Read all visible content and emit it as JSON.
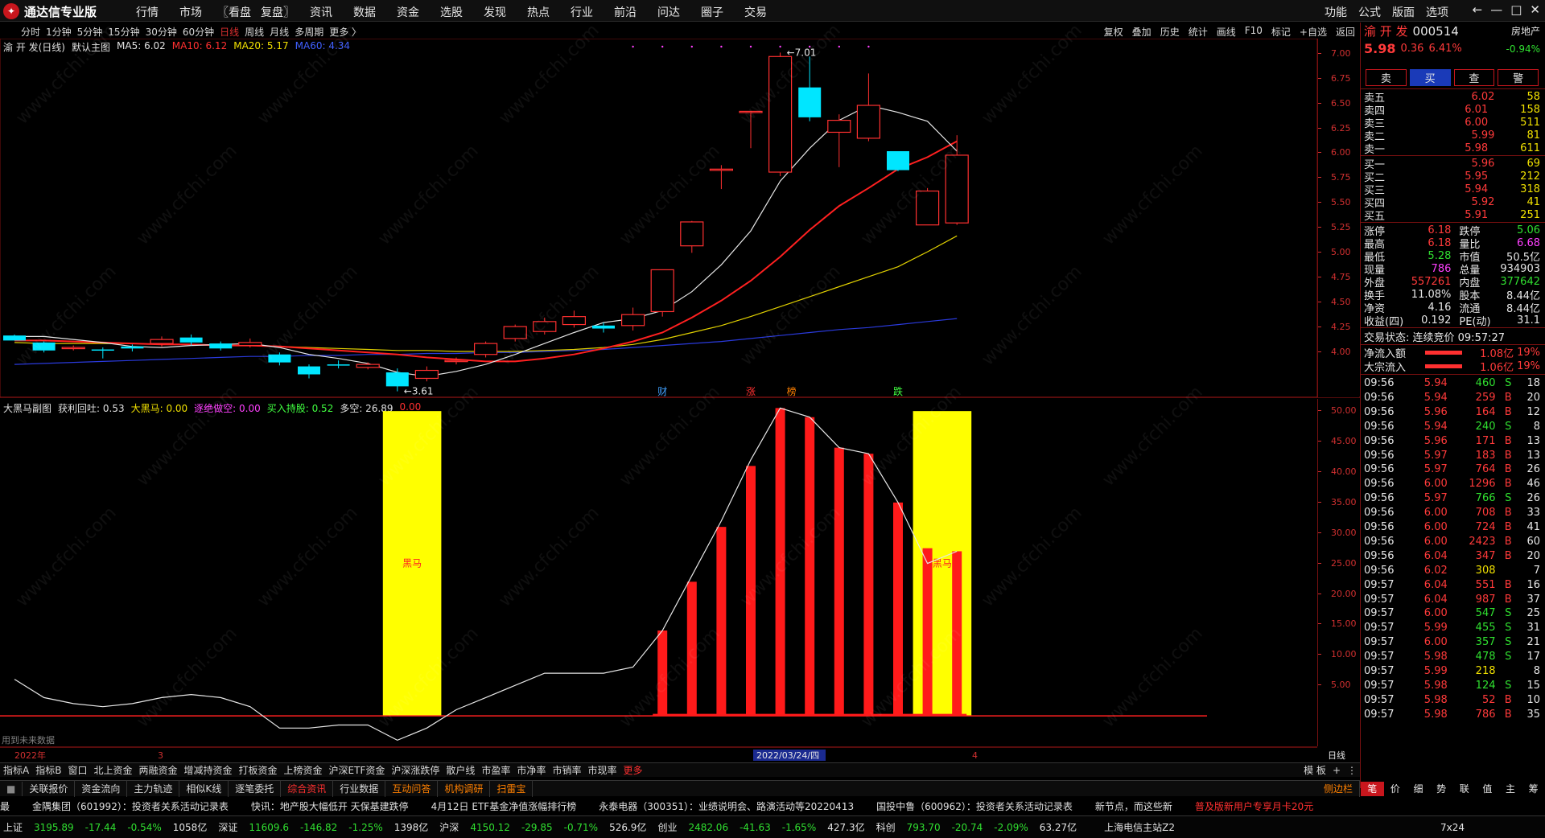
{
  "app": {
    "name": "通达信专业版",
    "logo_icon": "tdx-logo-icon"
  },
  "main_menu": [
    "行情",
    "市场",
    "〖看盘",
    "复盘〗",
    "资讯",
    "数据",
    "资金",
    "选股",
    "发现",
    "热点",
    "行业",
    "前沿",
    "问达",
    "圈子",
    "交易"
  ],
  "right_menu": [
    "功能",
    "公式",
    "版面",
    "选项"
  ],
  "window_controls": [
    "←",
    "—",
    "□",
    "✕"
  ],
  "periods": [
    "分时",
    "1分钟",
    "5分钟",
    "15分钟",
    "30分钟",
    "60分钟",
    "日线",
    "周线",
    "月线",
    "多周期",
    "更多 〉"
  ],
  "active_period": "日线",
  "tool_buttons": [
    "复权",
    "叠加",
    "历史",
    "统计",
    "画线",
    "F10",
    "标记",
    "+自选",
    "返回"
  ],
  "stock": {
    "name": "渝 开 发",
    "code": "000514",
    "sector": "房地产",
    "sector_change": "-0.94%",
    "price": "5.98",
    "change": "0.36",
    "change_pct": "6.41%"
  },
  "main_legend": {
    "title": "渝 开 发(日线)",
    "template": "默认主图",
    "ma5": "MA5: 6.02",
    "ma10": "MA10: 6.12",
    "ma20": "MA20: 5.17",
    "ma60": "MA60: 4.34"
  },
  "sub_legend": {
    "title": "大黑马副图",
    "v1": "获利回吐: 0.53",
    "v2": "大黑马: 0.00",
    "v3": "逐绝做空: 0.00",
    "v4": "买入持股: 0.52",
    "v5": "多空: 26.89",
    "v6": "0.00"
  },
  "annotations": {
    "high": "7.01",
    "low": "3.61",
    "black_horse": "黑马",
    "future_data": "用到未来数据",
    "date_box": "2022/03/24/四",
    "year_label": "2022年",
    "month3": "3",
    "month4": "4",
    "period_label": "日线"
  },
  "event_marks": [
    {
      "label": "财"
    },
    {
      "label": "涨"
    },
    {
      "label": "榜"
    },
    {
      "label": "跌"
    }
  ],
  "main_axis": [
    "7.00",
    "6.75",
    "6.50",
    "6.25",
    "6.00",
    "5.75",
    "5.50",
    "5.25",
    "5.00",
    "4.75",
    "4.50",
    "4.25",
    "4.00"
  ],
  "sub_axis": [
    "50.00",
    "45.00",
    "40.00",
    "35.00",
    "30.00",
    "25.00",
    "20.00",
    "15.00",
    "10.00",
    "5.00"
  ],
  "chart_data": {
    "type": "candlestick",
    "candles": [
      [
        4.17,
        4.12,
        4.18,
        4.12
      ],
      [
        4.1,
        4.02,
        4.11,
        4.0
      ],
      [
        4.05,
        4.05,
        4.07,
        4.02
      ],
      [
        4.03,
        4.02,
        4.05,
        3.94
      ],
      [
        4.06,
        4.04,
        4.08,
        4.01
      ],
      [
        4.09,
        4.13,
        4.16,
        4.06
      ],
      [
        4.15,
        4.1,
        4.18,
        4.07
      ],
      [
        4.09,
        4.04,
        4.11,
        4.02
      ],
      [
        4.07,
        4.1,
        4.14,
        4.05
      ],
      [
        3.98,
        3.9,
        4.0,
        3.87
      ],
      [
        3.86,
        3.78,
        3.88,
        3.74
      ],
      [
        3.88,
        3.87,
        3.92,
        3.84
      ],
      [
        3.85,
        3.88,
        3.9,
        3.83
      ],
      [
        3.8,
        3.66,
        3.84,
        3.61
      ],
      [
        3.74,
        3.82,
        3.86,
        3.71
      ],
      [
        3.92,
        3.92,
        3.95,
        3.88
      ],
      [
        3.98,
        4.09,
        4.11,
        3.95
      ],
      [
        4.14,
        4.26,
        4.28,
        4.11
      ],
      [
        4.21,
        4.31,
        4.35,
        4.18
      ],
      [
        4.28,
        4.36,
        4.42,
        4.25
      ],
      [
        4.27,
        4.24,
        4.3,
        4.2
      ],
      [
        4.27,
        4.38,
        4.45,
        4.22
      ],
      [
        4.41,
        4.83,
        4.83,
        4.36
      ],
      [
        5.07,
        5.31,
        5.32,
        5.0
      ],
      [
        5.84,
        5.84,
        5.88,
        5.64
      ],
      [
        6.42,
        6.42,
        6.42,
        6.05
      ],
      [
        5.81,
        6.97,
        7.01,
        5.77
      ],
      [
        6.66,
        6.36,
        6.97,
        6.32
      ],
      [
        6.21,
        6.33,
        6.39,
        5.86
      ],
      [
        6.15,
        6.48,
        6.8,
        6.12
      ],
      [
        6.02,
        5.83,
        6.01,
        5.82
      ],
      [
        5.28,
        5.62,
        5.65,
        5.28
      ],
      [
        5.3,
        5.98,
        6.18,
        5.28
      ]
    ],
    "ma5": [
      4.16,
      4.16,
      4.13,
      4.1,
      4.06,
      4.05,
      4.07,
      4.08,
      4.09,
      4.05,
      3.98,
      3.94,
      3.89,
      3.8,
      3.76,
      3.81,
      3.88,
      3.98,
      4.09,
      4.2,
      4.3,
      4.34,
      4.42,
      4.61,
      4.88,
      5.22,
      5.72,
      6.05,
      6.33,
      6.48,
      6.41,
      6.32,
      6.02
    ],
    "ma10": [
      4.12,
      4.12,
      4.11,
      4.1,
      4.09,
      4.08,
      4.08,
      4.07,
      4.07,
      4.06,
      4.04,
      4.02,
      4.0,
      3.98,
      3.95,
      3.93,
      3.91,
      3.91,
      3.94,
      3.98,
      4.04,
      4.11,
      4.2,
      4.35,
      4.52,
      4.72,
      4.96,
      5.23,
      5.47,
      5.65,
      5.84,
      5.96,
      6.12
    ],
    "ma20": [
      4.1,
      4.09,
      4.09,
      4.09,
      4.09,
      4.08,
      4.08,
      4.07,
      4.07,
      4.06,
      4.05,
      4.04,
      4.03,
      4.02,
      4.02,
      4.01,
      4.01,
      4.01,
      4.02,
      4.03,
      4.05,
      4.08,
      4.13,
      4.2,
      4.27,
      4.36,
      4.46,
      4.56,
      4.66,
      4.76,
      4.86,
      5.01,
      5.17
    ],
    "ma60": [
      3.88,
      3.89,
      3.9,
      3.91,
      3.92,
      3.93,
      3.94,
      3.95,
      3.96,
      3.96,
      3.97,
      3.97,
      3.98,
      3.98,
      3.99,
      3.99,
      4.0,
      4.0,
      4.01,
      4.02,
      4.03,
      4.05,
      4.07,
      4.09,
      4.11,
      4.14,
      4.17,
      4.2,
      4.23,
      4.25,
      4.28,
      4.31,
      4.34
    ],
    "ylim": [
      3.55,
      7.15
    ],
    "sub": {
      "line": [
        6,
        3,
        2,
        1.5,
        2,
        3,
        3.5,
        3,
        1.5,
        -2,
        -2,
        -1.5,
        -1.5,
        -4,
        -2,
        1,
        3,
        5,
        7,
        7,
        7,
        8,
        14,
        23,
        32,
        42,
        50.5,
        49,
        44,
        43,
        35,
        25,
        27
      ],
      "red_bars": [
        0,
        0,
        0,
        0,
        0,
        0,
        0,
        0,
        0,
        0,
        0,
        0,
        0,
        0,
        0,
        0,
        0,
        0,
        0,
        0,
        0,
        0,
        14,
        22,
        31,
        41,
        50.5,
        49,
        44,
        43,
        35,
        27.5,
        27
      ],
      "yellow_bars": [
        {
          "from": 13,
          "to": 14
        },
        {
          "from": 31,
          "to": 32
        }
      ],
      "ylim": [
        -5,
        52
      ]
    }
  },
  "orderbook": {
    "labels": {
      "sell": "卖",
      "buy": "买",
      "query": "查",
      "warn": "警"
    },
    "asks": [
      {
        "l": "卖五",
        "p": "6.02",
        "v": "58"
      },
      {
        "l": "卖四",
        "p": "6.01",
        "v": "158"
      },
      {
        "l": "卖三",
        "p": "6.00",
        "v": "511"
      },
      {
        "l": "卖二",
        "p": "5.99",
        "v": "81"
      },
      {
        "l": "卖一",
        "p": "5.98",
        "v": "611"
      }
    ],
    "bids": [
      {
        "l": "买一",
        "p": "5.96",
        "v": "69"
      },
      {
        "l": "买二",
        "p": "5.95",
        "v": "212"
      },
      {
        "l": "买三",
        "p": "5.94",
        "v": "318"
      },
      {
        "l": "买四",
        "p": "5.92",
        "v": "41"
      },
      {
        "l": "买五",
        "p": "5.91",
        "v": "251"
      }
    ]
  },
  "stats": [
    {
      "a": "涨停",
      "av": "6.18",
      "b": "跌停",
      "bv": "5.06"
    },
    {
      "a": "最高",
      "av": "6.18",
      "b": "量比",
      "bv": "6.68"
    },
    {
      "a": "最低",
      "av": "5.28",
      "b": "市值",
      "bv": "50.5亿"
    },
    {
      "a": "现量",
      "av": "786",
      "b": "总量",
      "bv": "934903"
    },
    {
      "a": "外盘",
      "av": "557261",
      "b": "内盘",
      "bv": "377642"
    },
    {
      "a": "换手",
      "av": "11.08%",
      "b": "股本",
      "bv": "8.44亿"
    },
    {
      "a": "净资",
      "av": "4.16",
      "b": "流通",
      "bv": "8.44亿"
    },
    {
      "a": "收益(四)",
      "av": "0.192",
      "b": "PE(动)",
      "bv": "31.1"
    }
  ],
  "trade_status": "交易状态: 连续竞价 09:57:27",
  "flows": [
    {
      "label": "净流入额",
      "value": "1.08亿",
      "pct": "19%"
    },
    {
      "label": "大宗流入",
      "value": "1.06亿",
      "pct": "19%"
    }
  ],
  "ticks": [
    [
      "09:56",
      "5.94",
      "460",
      "S",
      "18"
    ],
    [
      "09:56",
      "5.94",
      "259",
      "B",
      "20"
    ],
    [
      "09:56",
      "5.96",
      "164",
      "B",
      "12"
    ],
    [
      "09:56",
      "5.94",
      "240",
      "S",
      "8"
    ],
    [
      "09:56",
      "5.96",
      "171",
      "B",
      "13"
    ],
    [
      "09:56",
      "5.97",
      "183",
      "B",
      "13"
    ],
    [
      "09:56",
      "5.97",
      "764",
      "B",
      "26"
    ],
    [
      "09:56",
      "6.00",
      "1296",
      "B",
      "46"
    ],
    [
      "09:56",
      "5.97",
      "766",
      "S",
      "26"
    ],
    [
      "09:56",
      "6.00",
      "708",
      "B",
      "33"
    ],
    [
      "09:56",
      "6.00",
      "724",
      "B",
      "41"
    ],
    [
      "09:56",
      "6.00",
      "2423",
      "B",
      "60"
    ],
    [
      "09:56",
      "6.04",
      "347",
      "B",
      "20"
    ],
    [
      "09:56",
      "6.02",
      "308",
      "",
      "7"
    ],
    [
      "09:57",
      "6.04",
      "551",
      "B",
      "16"
    ],
    [
      "09:57",
      "6.04",
      "987",
      "B",
      "37"
    ],
    [
      "09:57",
      "6.00",
      "547",
      "S",
      "25"
    ],
    [
      "09:57",
      "5.99",
      "455",
      "S",
      "31"
    ],
    [
      "09:57",
      "6.00",
      "357",
      "S",
      "21"
    ],
    [
      "09:57",
      "5.98",
      "478",
      "S",
      "17"
    ],
    [
      "09:57",
      "5.99",
      "218",
      "",
      "8"
    ],
    [
      "09:57",
      "5.98",
      "124",
      "S",
      "15"
    ],
    [
      "09:57",
      "5.98",
      "52",
      "B",
      "10"
    ],
    [
      "09:57",
      "5.98",
      "786",
      "B",
      "35"
    ]
  ],
  "side_tabs": [
    "笔",
    "价",
    "细",
    "势",
    "联",
    "值",
    "主",
    "筹"
  ],
  "indicator_tabs": [
    "指标A",
    "指标B",
    "窗口",
    "北上资金",
    "两融资金",
    "增减持资金",
    "打板资金",
    "上榜资金",
    "沪深ETF资金",
    "沪深涨跌停",
    "散户线",
    "市盈率",
    "市净率",
    "市销率",
    "市现率",
    "更多"
  ],
  "indicator_right": [
    "模 板",
    "+",
    "⋮"
  ],
  "function_tabs": [
    "关联报价",
    "资金流向",
    "主力轨迹",
    "相似K线",
    "逐笔委托",
    "综合资讯",
    "行业数据",
    "互动问答",
    "机构调研",
    "扫雷宝"
  ],
  "function_right": "侧边栏",
  "news_ticker": [
    "最",
    "金隅集团（601992）：投资者关系活动记录表",
    "快讯：地产股大幅低开 天保基建跌停",
    "4月12日 ETF基金净值涨幅排行榜",
    "永泰电器（300351）：业绩说明会、路演活动等20220413",
    "国投中鲁（600962）：投资者关系活动记录表",
    "新节点，而这些新",
    "普及版新用户专享月卡20元"
  ],
  "indices": [
    {
      "name": "上证",
      "val": "3195.89",
      "chg": "-17.44",
      "pct": "-0.54%",
      "amt": "1058亿"
    },
    {
      "name": "深证",
      "val": "11609.6",
      "chg": "-146.82",
      "pct": "-1.25%",
      "amt": "1398亿"
    },
    {
      "name": "沪深",
      "val": "4150.12",
      "chg": "-29.85",
      "pct": "-0.71%",
      "amt": "526.9亿"
    },
    {
      "name": "创业",
      "val": "2482.06",
      "chg": "-41.63",
      "pct": "-1.65%",
      "amt": "427.3亿"
    },
    {
      "name": "科创",
      "val": "793.70",
      "chg": "-20.74",
      "pct": "-2.09%",
      "amt": "63.27亿"
    }
  ],
  "server": "上海电信主站Z2",
  "clock": "7x24",
  "watermark": "www.cfchi.com"
}
